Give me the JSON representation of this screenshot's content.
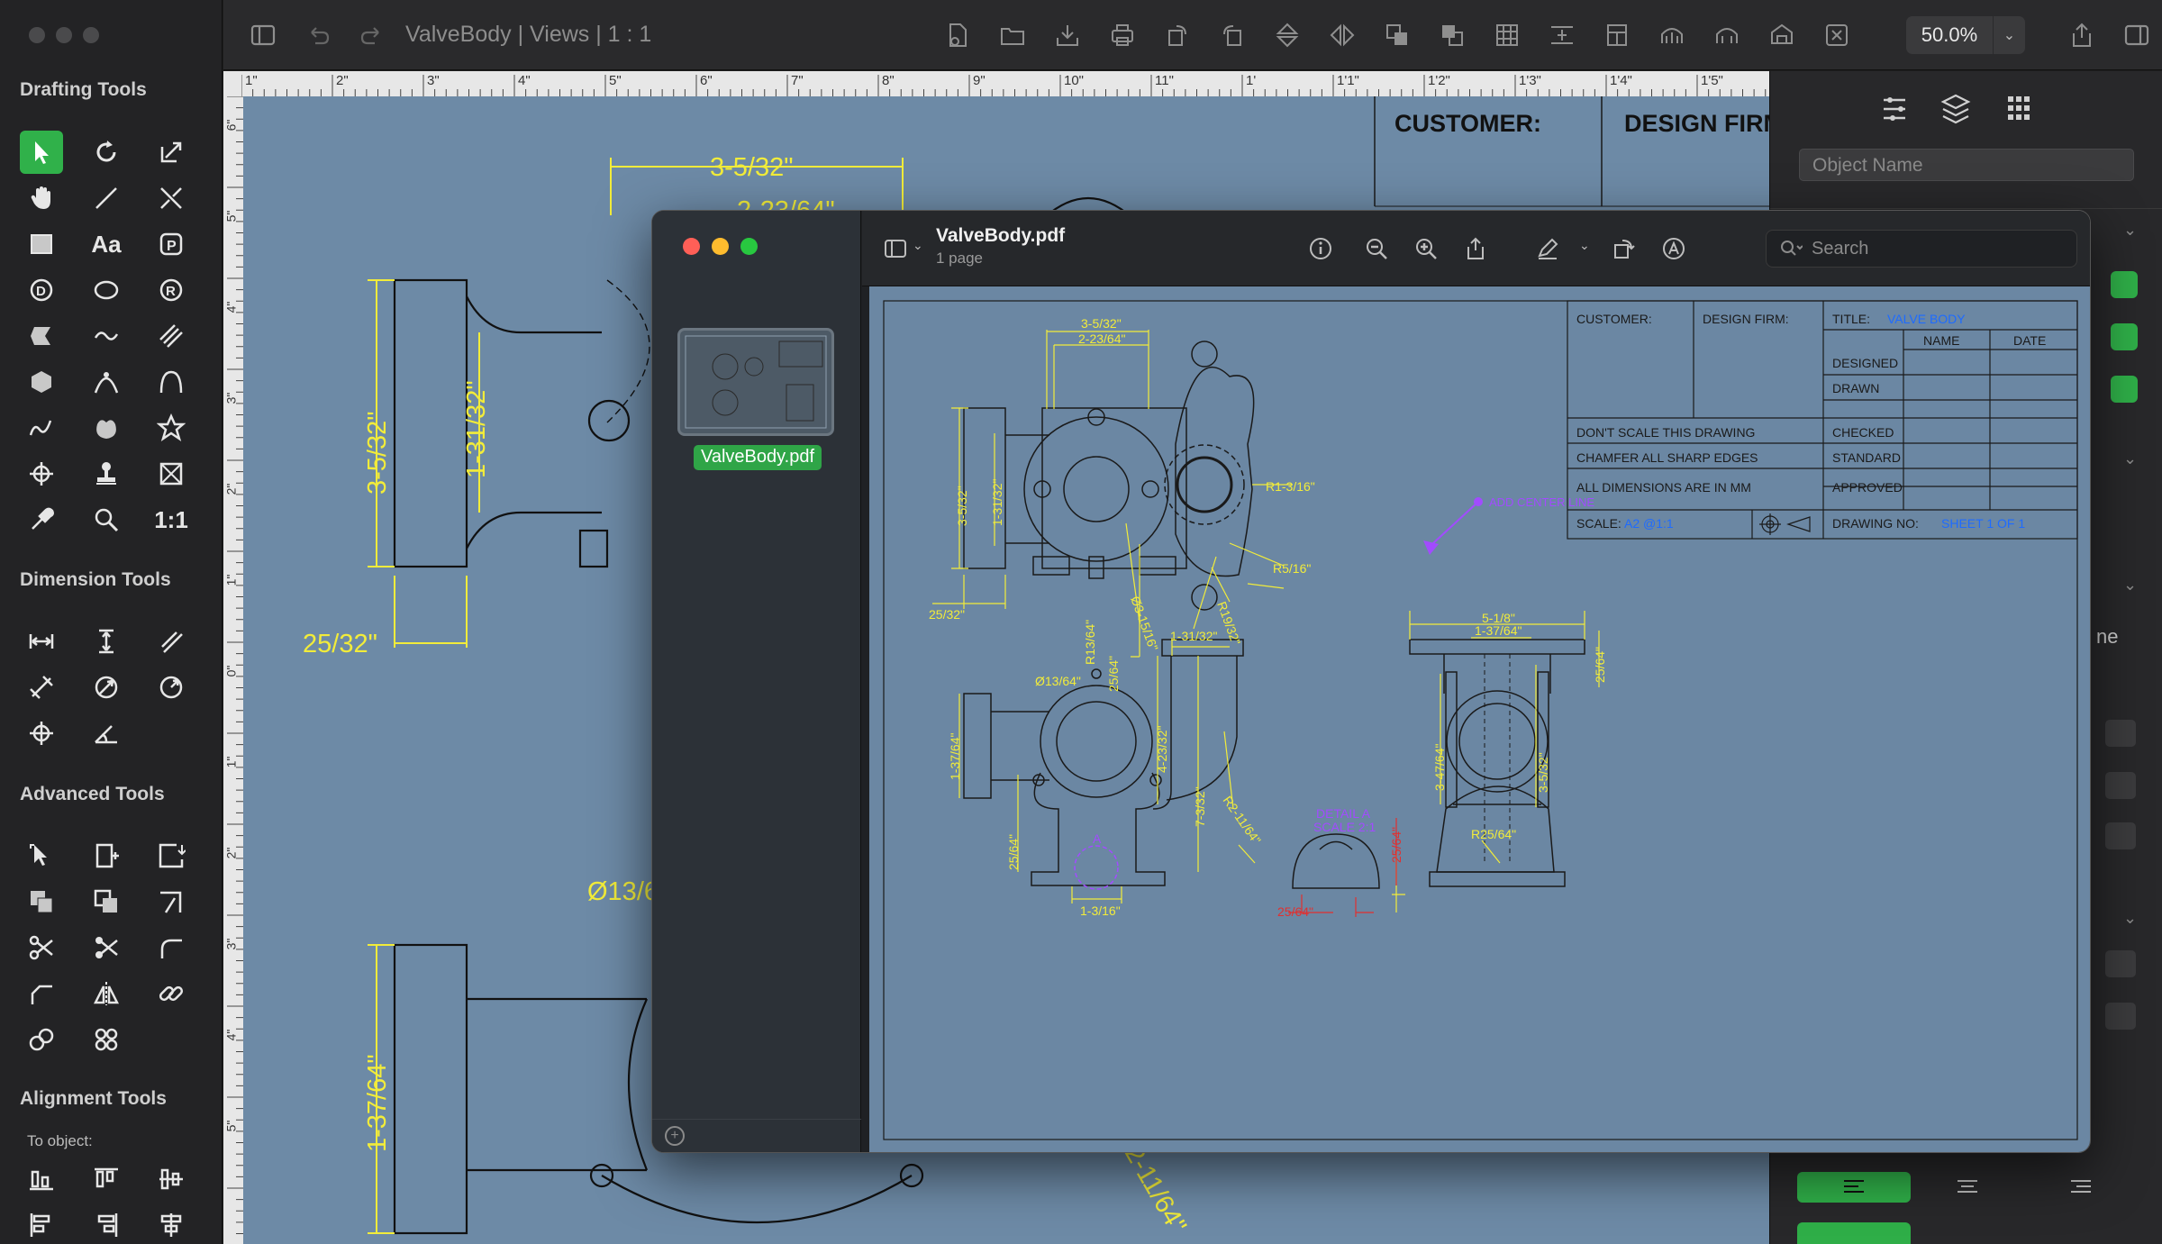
{
  "window": {
    "doc_title": "ValveBody | Views | 1 : 1",
    "zoom": "50.0%"
  },
  "sidebar": {
    "sections": {
      "drafting": "Drafting Tools",
      "dimension": "Dimension Tools",
      "advanced": "Advanced Tools",
      "alignment": "Alignment Tools"
    },
    "scale_tool_label": "1:1",
    "text_tool_label": "Aa",
    "to_object_label": "To object:"
  },
  "canvas": {
    "title_block": {
      "customer": "CUSTOMER:",
      "design_firm": "DESIGN FIRM"
    },
    "dims": {
      "d1": "3-5/32\"",
      "d2": "2-23/64\"",
      "d3": "3-5/32\"",
      "d4": "1-31/32\"",
      "d5": "25/32\"",
      "d6": "Ø13/6",
      "d7": "1-37/64\"",
      "d8": "2-11/64\""
    },
    "ruler_top": [
      "1\"",
      "2\"",
      "3\"",
      "4\"",
      "5\"",
      "6\"",
      "7\"",
      "8\"",
      "9\"",
      "10\"",
      "11\"",
      "1'",
      "1'1\"",
      "1'2\"",
      "1'3\"",
      "1'4\"",
      "1'5\""
    ],
    "ruler_left": [
      "6\"",
      "5\"",
      "4\"",
      "3\"",
      "2\"",
      "1\"",
      "0\"",
      "1\"",
      "2\"",
      "3\"",
      "4\"",
      "5\""
    ]
  },
  "inspector": {
    "object_name_placeholder": "Object Name",
    "fragment_text": "ne"
  },
  "preview": {
    "file_name": "ValveBody.pdf",
    "page_count": "1 page",
    "thumb_label": "ValveBody.pdf",
    "search_placeholder": "Search",
    "drawing": {
      "customer": "CUSTOMER:",
      "design_firm": "DESIGN FIRM:",
      "title_label": "TITLE:",
      "title_value": "VALVE BODY",
      "name_col": "NAME",
      "date_col": "DATE",
      "rows": [
        "DESIGNED",
        "DRAWN",
        "CHECKED",
        "STANDARD",
        "APPROVED"
      ],
      "notes": [
        "DON'T SCALE THIS DRAWING",
        "CHAMFER ALL SHARP EDGES",
        "ALL DIMENSIONS ARE IN MM"
      ],
      "scale_label": "SCALE:",
      "scale_value": "A2 @1:1",
      "drawing_no_label": "DRAWING NO:",
      "drawing_no_value": "SHEET 1 OF 1",
      "center_line_note": "ADD CENTER LINE",
      "detail_label": "DETAIL A",
      "detail_scale": "SCALE 2:1",
      "detail_marker": "A",
      "dims": {
        "a": "3-5/32\"",
        "b": "2-23/64\"",
        "c": "3-5/32\"",
        "d": "1-31/32\"",
        "e": "25/32\"",
        "f": "Ø3-15/16\"",
        "g": "R1-3/16\"",
        "h": "R5/16\"",
        "i": "R19/32\"",
        "j": "R13/64\"",
        "k": "Ø13/64\"",
        "l": "25/64\"",
        "m": "1-31/32\"",
        "n": "4-23/32\"",
        "o": "7-3/32\"",
        "p": "R2-11/64\"",
        "q": "1-37/64\"",
        "r": "25/64\"",
        "s": "1-3/16\"",
        "t": "5-1/8\"",
        "u": "1-37/64\"",
        "v": "25/64\"",
        "w": "3-47/64\"",
        "x": "3-5/32\"",
        "y": "R25/64\"",
        "z": "25/64\"",
        "z2": "25/64\""
      }
    }
  },
  "colors": {
    "accent_green": "#30b14a",
    "canvas_blue": "#6d8aa6",
    "dim_yellow": "#f2ec3a",
    "note_purple": "#a24bff",
    "red_dim": "#e03030"
  }
}
